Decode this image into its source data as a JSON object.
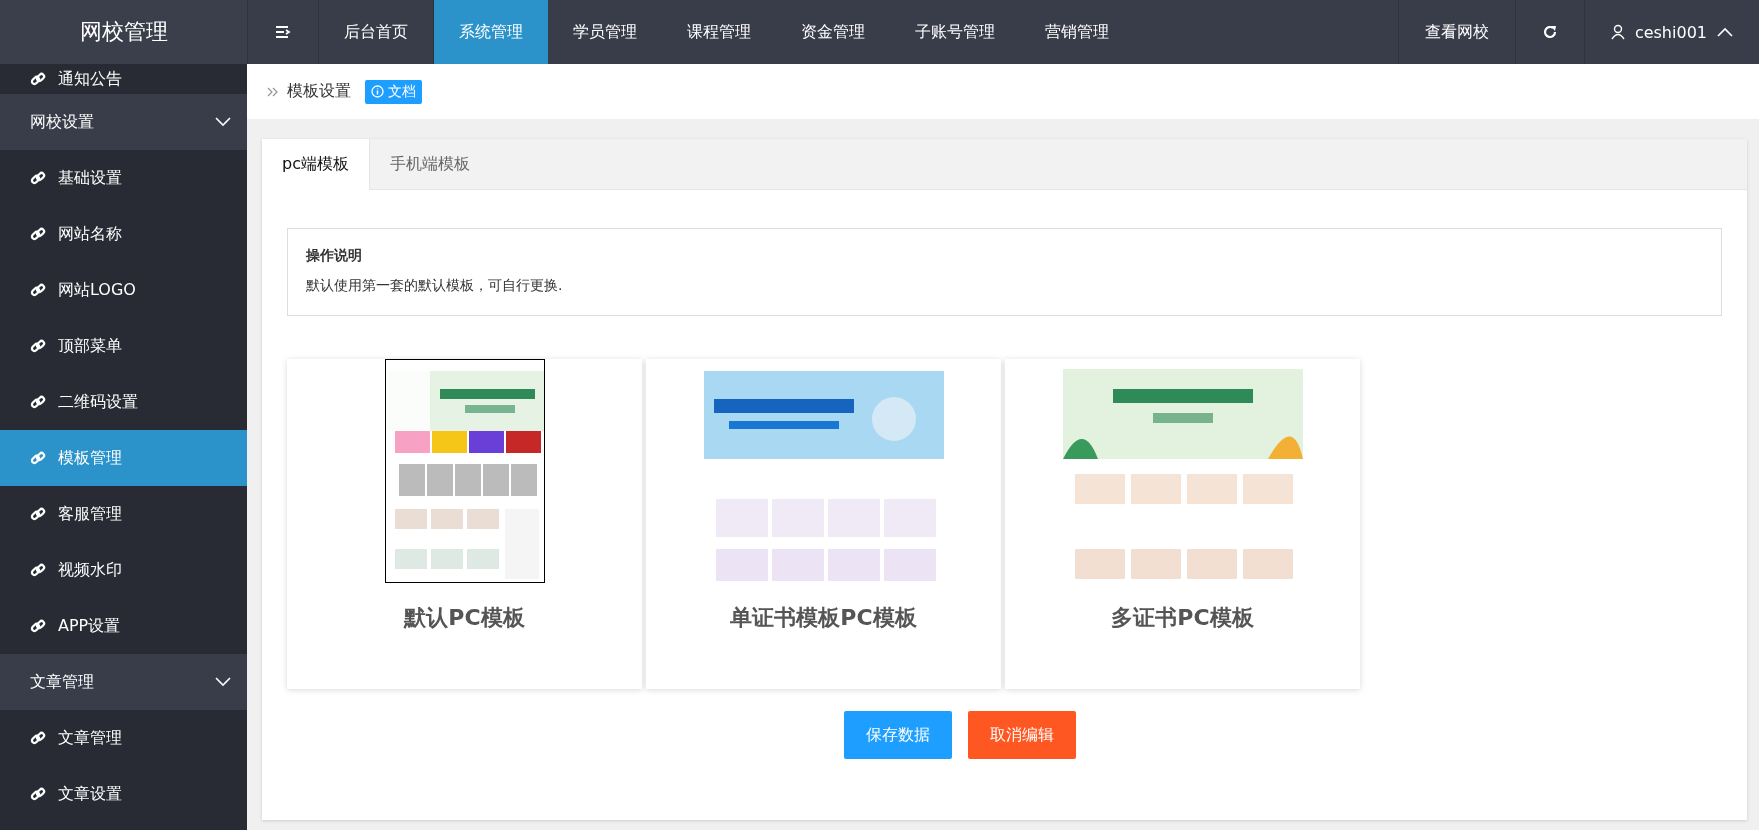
{
  "logo": "网校管理",
  "top_nav": [
    {
      "label": "后台首页",
      "selected": false
    },
    {
      "label": "系统管理",
      "selected": true
    },
    {
      "label": "学员管理",
      "selected": false
    },
    {
      "label": "课程管理",
      "selected": false
    },
    {
      "label": "资金管理",
      "selected": false
    },
    {
      "label": "子账号管理",
      "selected": false
    },
    {
      "label": "营销管理",
      "selected": false
    }
  ],
  "header_right": {
    "view_school": "查看网校",
    "user": "ceshi001"
  },
  "sidebar": [
    {
      "kind": "item",
      "label": "通知公告",
      "selected": false
    },
    {
      "kind": "group",
      "label": "网校设置",
      "expanded": true
    },
    {
      "kind": "item",
      "label": "基础设置",
      "selected": false
    },
    {
      "kind": "item",
      "label": "网站名称",
      "selected": false
    },
    {
      "kind": "item",
      "label": "网站LOGO",
      "selected": false
    },
    {
      "kind": "item",
      "label": "顶部菜单",
      "selected": false
    },
    {
      "kind": "item",
      "label": "二维码设置",
      "selected": false
    },
    {
      "kind": "item",
      "label": "模板管理",
      "selected": true
    },
    {
      "kind": "item",
      "label": "客服管理",
      "selected": false
    },
    {
      "kind": "item",
      "label": "视频水印",
      "selected": false
    },
    {
      "kind": "item",
      "label": "APP设置",
      "selected": false
    },
    {
      "kind": "group",
      "label": "文章管理",
      "expanded": true
    },
    {
      "kind": "item",
      "label": "文章管理",
      "selected": false
    },
    {
      "kind": "item",
      "label": "文章设置",
      "selected": false
    }
  ],
  "breadcrumb": {
    "title": "模板设置",
    "doc_badge": "文档"
  },
  "tabs": [
    {
      "label": "pc端模板",
      "selected": true
    },
    {
      "label": "手机端模板",
      "selected": false
    }
  ],
  "notice": {
    "title": "操作说明",
    "text": "默认使用第一套的默认模板，可自行更换."
  },
  "templates": [
    {
      "name": "默认PC模板",
      "selected": true,
      "kind": "sidebar-banner"
    },
    {
      "name": "单证书模板PC模板",
      "selected": false,
      "kind": "blue-banner"
    },
    {
      "name": "多证书PC模板",
      "selected": false,
      "kind": "green-banner"
    }
  ],
  "buttons": {
    "save": "保存数据",
    "cancel": "取消编辑"
  }
}
